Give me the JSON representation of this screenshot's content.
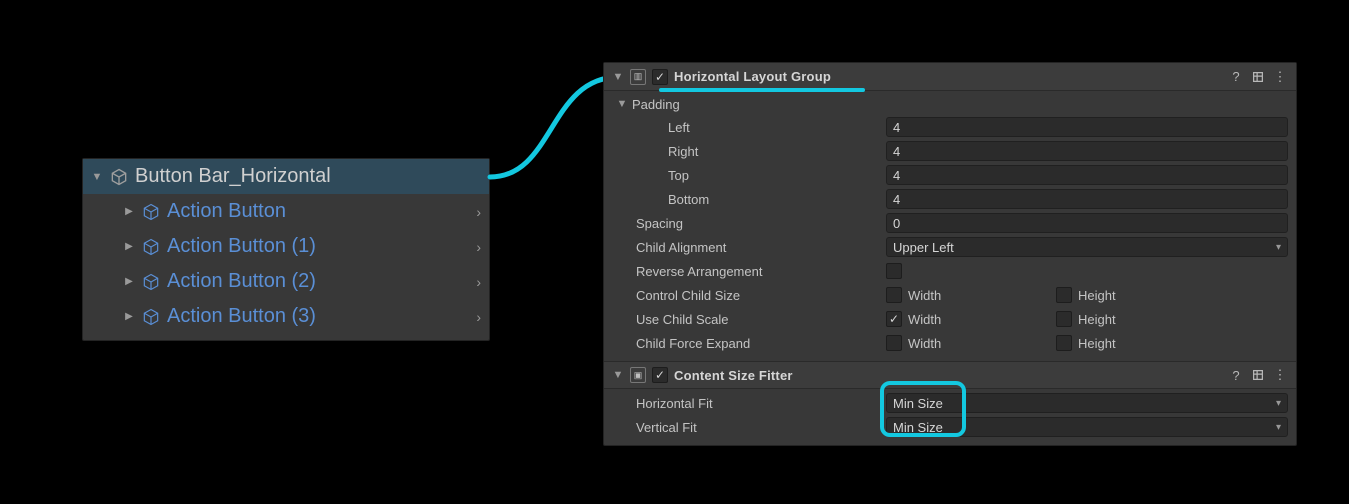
{
  "hierarchy": {
    "parent": "Button Bar_Horizontal",
    "children": [
      "Action Button",
      "Action Button (1)",
      "Action Button (2)",
      "Action Button (3)"
    ]
  },
  "inspector": {
    "hlg": {
      "title": "Horizontal Layout Group",
      "padding_label": "Padding",
      "left_label": "Left",
      "left_val": "4",
      "right_label": "Right",
      "right_val": "4",
      "top_label": "Top",
      "top_val": "4",
      "bottom_label": "Bottom",
      "bottom_val": "4",
      "spacing_label": "Spacing",
      "spacing_val": "0",
      "child_align_label": "Child Alignment",
      "child_align_val": "Upper Left",
      "reverse_label": "Reverse Arrangement",
      "ctrl_label": "Control Child Size",
      "scale_label": "Use Child Scale",
      "force_label": "Child Force Expand",
      "width_label": "Width",
      "height_label": "Height"
    },
    "csf": {
      "title": "Content Size Fitter",
      "hfit_label": "Horizontal Fit",
      "hfit_val": "Min Size",
      "vfit_label": "Vertical Fit",
      "vfit_val": "Min Size"
    }
  }
}
